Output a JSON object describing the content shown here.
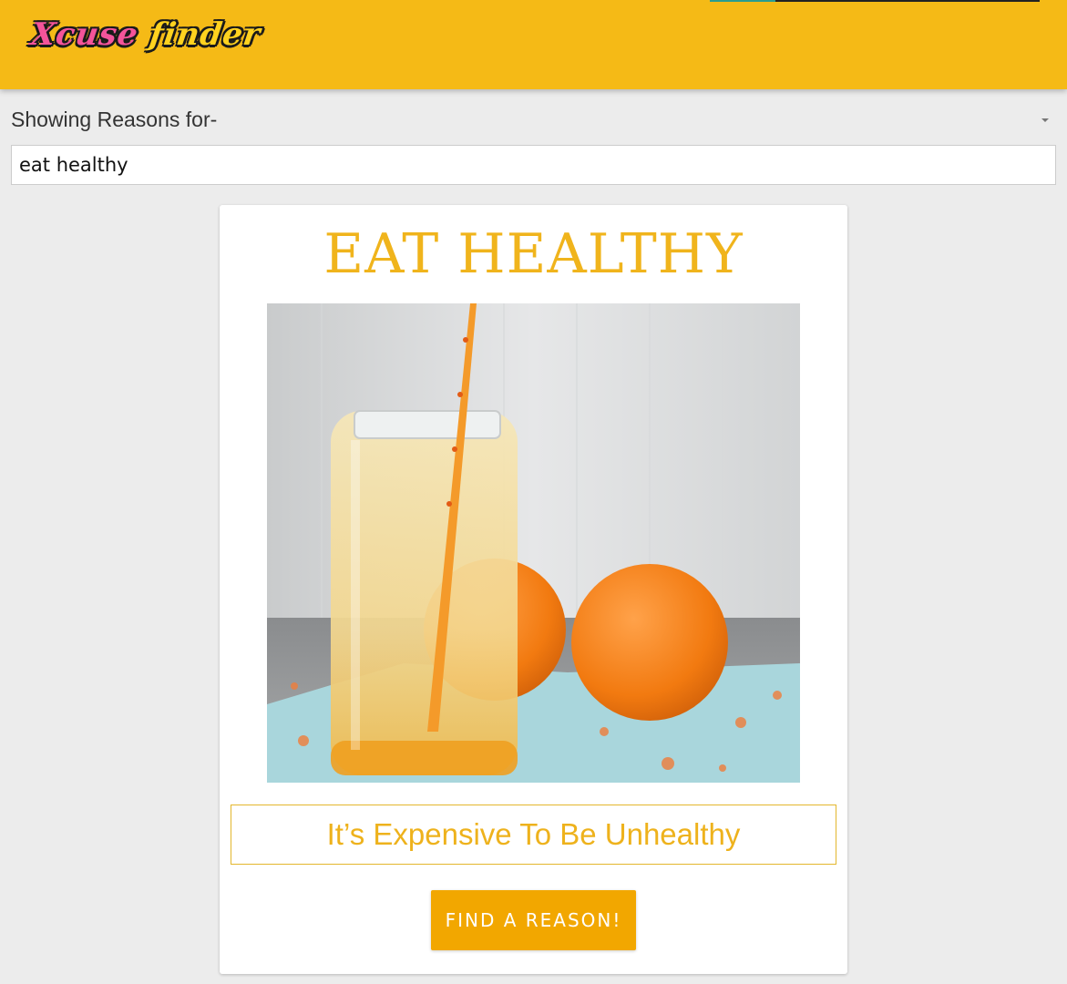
{
  "header": {
    "logo_word1": "Xcuse",
    "logo_word2": "finder"
  },
  "filter": {
    "label": "Showing Reasons for-",
    "search_value": "eat healthy"
  },
  "card": {
    "title": "EAT HEALTHY",
    "image_alt": "Glass jar of orange drink with a straw next to two oranges",
    "reason": "It’s Expensive To Be Unhealthy",
    "button_label": "FIND A REASON!"
  },
  "colors": {
    "header_bg": "#f5ba16",
    "accent": "#f0b41c",
    "button": "#f2a700",
    "page_bg": "#ececec"
  },
  "icons": {
    "dropdown": "caret-down-icon"
  }
}
